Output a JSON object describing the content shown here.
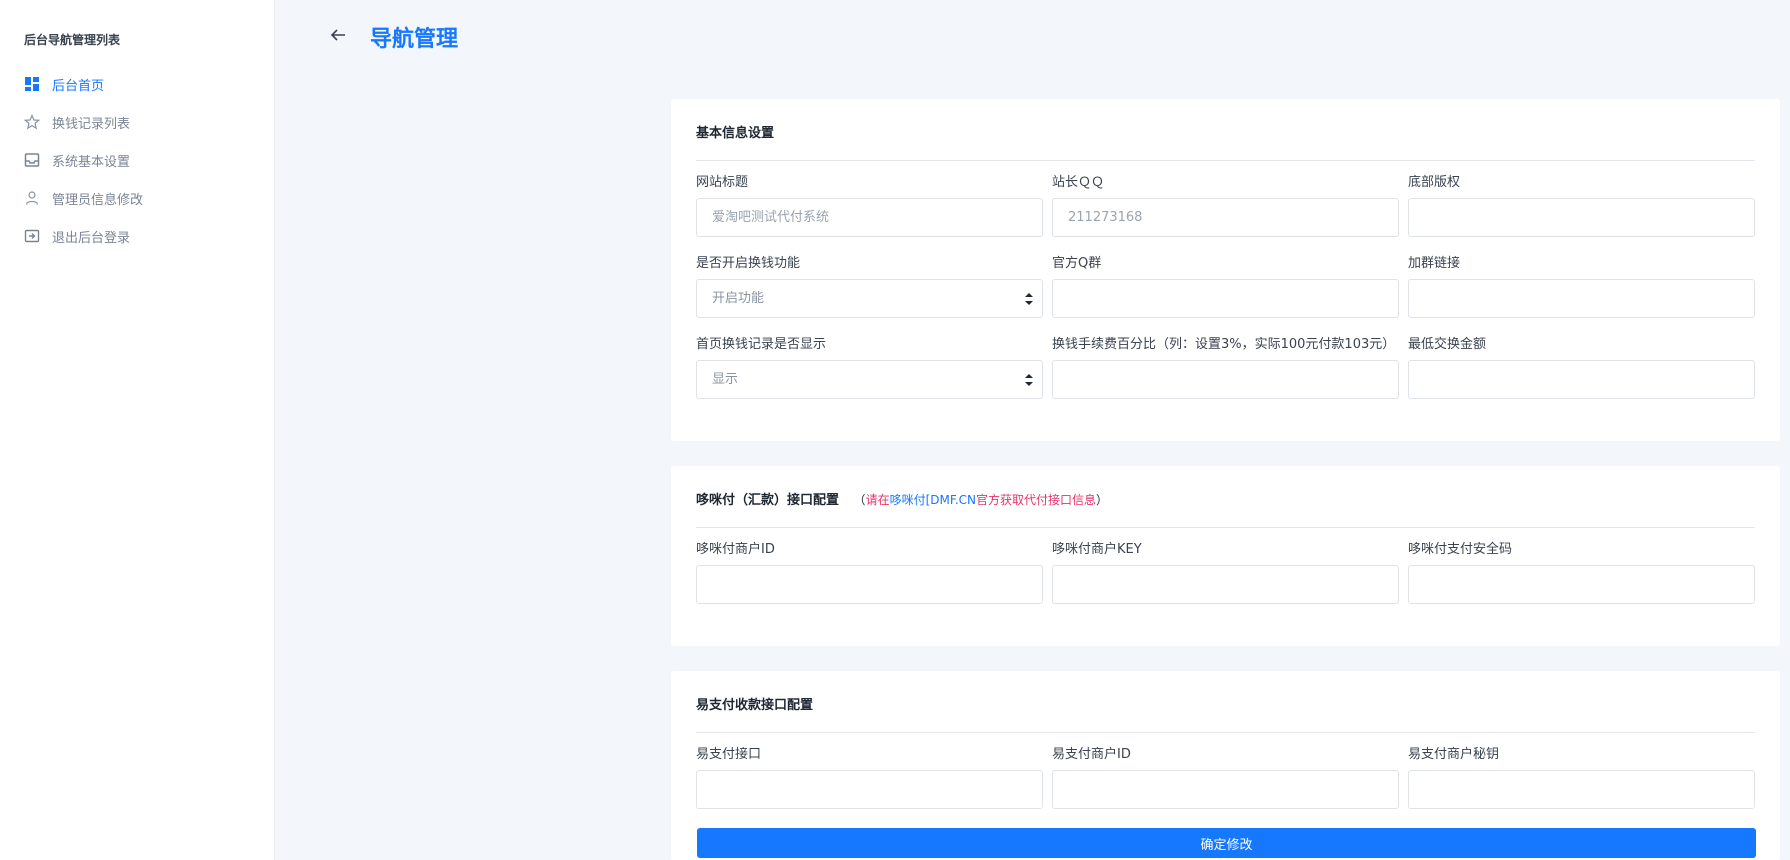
{
  "sidebar": {
    "title": "后台导航管理列表",
    "items": [
      {
        "label": "后台首页"
      },
      {
        "label": "换钱记录列表"
      },
      {
        "label": "系统基本设置"
      },
      {
        "label": "管理员信息修改"
      },
      {
        "label": "退出后台登录"
      }
    ]
  },
  "header": {
    "title": "导航管理"
  },
  "basic": {
    "title": "基本信息设置",
    "site_title_label": "网站标题",
    "site_title_placeholder": "爱淘吧测试代付系统",
    "qq_label": "站长ＱＱ",
    "qq_placeholder": "211273168",
    "copyright_label": "底部版权",
    "copyright_value": "",
    "exchange_enable_label": "是否开启换钱功能",
    "exchange_enable_value": "开启功能",
    "qgroup_label": "官方Q群",
    "qgroup_value": "",
    "group_link_label": "加群链接",
    "group_link_value": "",
    "home_record_label": "首页换钱记录是否显示",
    "home_record_value": "显示",
    "fee_label": "换钱手续费百分比（列：设置3%，实际100元付款103元）",
    "fee_value": "",
    "min_amount_label": "最低交换金额",
    "min_amount_value": ""
  },
  "duomi": {
    "title": "哆咪付（汇款）接口配置",
    "note_open": "（",
    "note_pre": "请在",
    "note_link": "哆咪付[DMF.CN",
    "note_post": "官方获取代付接口信息",
    "note_close": "）",
    "merchant_id_label": "哆咪付商户ID",
    "merchant_key_label": "哆咪付商户KEY",
    "security_code_label": "哆咪付支付安全码"
  },
  "epay": {
    "title": "易支付收款接口配置",
    "api_label": "易支付接口",
    "merchant_id_label": "易支付商户ID",
    "merchant_secret_label": "易支付商户秘钥"
  },
  "submit_label": "确定修改",
  "colors": {
    "accent": "#1677ff",
    "note_pink": "#e8336b",
    "background": "#f3f6fa"
  }
}
